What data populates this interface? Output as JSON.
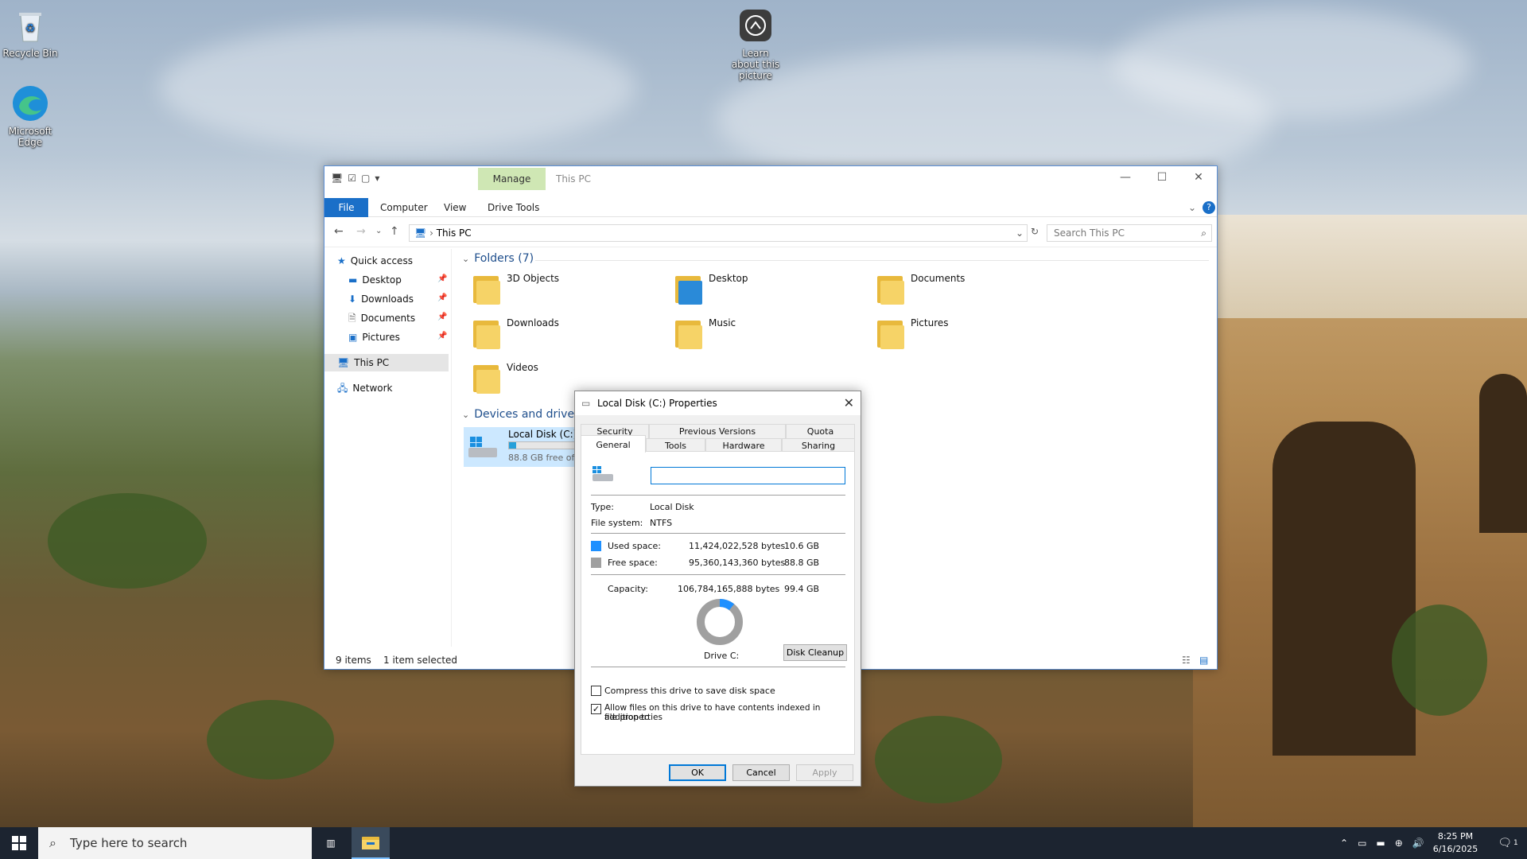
{
  "desktop": {
    "icons": [
      {
        "label": "Recycle Bin"
      },
      {
        "label": "Microsoft Edge"
      },
      {
        "label": "Learn about this picture"
      }
    ]
  },
  "explorer": {
    "title": "This PC",
    "contextual_tab": "Manage",
    "ribbon_tabs": [
      "File",
      "Computer",
      "View",
      "Drive Tools"
    ],
    "address": "This PC",
    "search_placeholder": "Search This PC",
    "nav": {
      "quick_access": "Quick access",
      "pinned": [
        "Desktop",
        "Downloads",
        "Documents",
        "Pictures"
      ],
      "this_pc": "This PC",
      "network": "Network"
    },
    "folders_header": "Folders (7)",
    "folders": [
      "3D Objects",
      "Desktop",
      "Documents",
      "Downloads",
      "Music",
      "Pictures",
      "Videos"
    ],
    "devices_header": "Devices and drives (",
    "drive": {
      "name": "Local Disk (C:)",
      "free_text": "88.8 GB free of 9",
      "used_fraction": 0.107
    },
    "status": {
      "items": "9 items",
      "selected": "1 item selected"
    }
  },
  "properties": {
    "title": "Local Disk (C:) Properties",
    "tabs_top": [
      "Security",
      "Previous Versions",
      "Quota"
    ],
    "tabs_bottom": [
      "General",
      "Tools",
      "Hardware",
      "Sharing"
    ],
    "name_value": "",
    "type_label": "Type:",
    "type_value": "Local Disk",
    "fs_label": "File system:",
    "fs_value": "NTFS",
    "used_label": "Used space:",
    "used_bytes": "11,424,022,528 bytes",
    "used_gb": "10.6 GB",
    "free_label": "Free space:",
    "free_bytes": "95,360,143,360 bytes",
    "free_gb": "88.8 GB",
    "cap_label": "Capacity:",
    "cap_bytes": "106,784,165,888 bytes",
    "cap_gb": "99.4 GB",
    "used_fraction": 0.107,
    "drive_label": "Drive C:",
    "cleanup": "Disk Cleanup",
    "compress": "Compress this drive to save disk space",
    "compress_checked": false,
    "index_line1": "Allow files on this drive to have contents indexed in addition to",
    "index_line2": "file properties",
    "index_checked": true,
    "ok": "OK",
    "cancel": "Cancel",
    "apply": "Apply",
    "colors": {
      "used": "#1e90ff",
      "free": "#a0a0a0"
    }
  },
  "taskbar": {
    "search_placeholder": "Type here to search",
    "time": "8:25 PM",
    "date": "6/16/2025",
    "notifications": "1"
  }
}
